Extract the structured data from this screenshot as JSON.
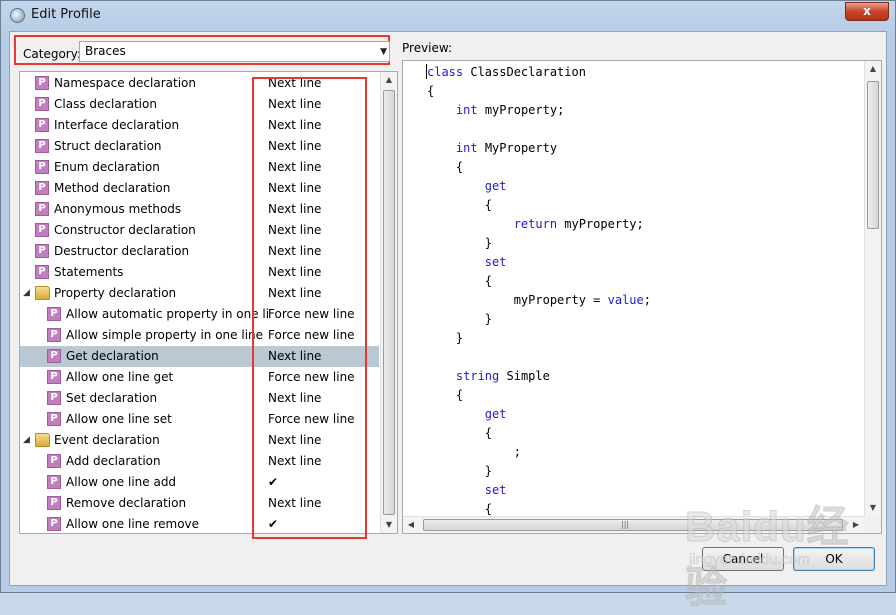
{
  "window": {
    "title": "Edit Profile",
    "close_label": "x",
    "icon": "app-gear-icon"
  },
  "category": {
    "label": "Category:",
    "selected": "Braces",
    "dropdown_icon": "chevron-down-icon"
  },
  "tree": {
    "rows": [
      {
        "label": "Namespace declaration",
        "value": "Next line",
        "level": 0,
        "icon": "p",
        "selected": false
      },
      {
        "label": "Class declaration",
        "value": "Next line",
        "level": 0,
        "icon": "p",
        "selected": false
      },
      {
        "label": "Interface declaration",
        "value": "Next line",
        "level": 0,
        "icon": "p",
        "selected": false
      },
      {
        "label": "Struct declaration",
        "value": "Next line",
        "level": 0,
        "icon": "p",
        "selected": false
      },
      {
        "label": "Enum declaration",
        "value": "Next line",
        "level": 0,
        "icon": "p",
        "selected": false
      },
      {
        "label": "Method declaration",
        "value": "Next line",
        "level": 0,
        "icon": "p",
        "selected": false
      },
      {
        "label": "Anonymous methods",
        "value": "Next line",
        "level": 0,
        "icon": "p",
        "selected": false
      },
      {
        "label": "Constructor declaration",
        "value": "Next line",
        "level": 0,
        "icon": "p",
        "selected": false
      },
      {
        "label": "Destructor declaration",
        "value": "Next line",
        "level": 0,
        "icon": "p",
        "selected": false
      },
      {
        "label": "Statements",
        "value": "Next line",
        "level": 0,
        "icon": "p",
        "selected": false
      },
      {
        "label": "Property declaration",
        "value": "Next line",
        "level": 0,
        "icon": "folder",
        "selected": false
      },
      {
        "label": "Allow automatic property in one line",
        "value": "Force new line",
        "level": 1,
        "icon": "p",
        "selected": false
      },
      {
        "label": "Allow simple property in one line",
        "value": "Force new line",
        "level": 1,
        "icon": "p",
        "selected": false
      },
      {
        "label": "Get declaration",
        "value": "Next line",
        "level": 1,
        "icon": "p",
        "selected": true
      },
      {
        "label": "Allow one line get",
        "value": "Force new line",
        "level": 1,
        "icon": "p",
        "selected": false
      },
      {
        "label": "Set declaration",
        "value": "Next line",
        "level": 1,
        "icon": "p",
        "selected": false
      },
      {
        "label": "Allow one line set",
        "value": "Force new line",
        "level": 1,
        "icon": "p",
        "selected": false
      },
      {
        "label": "Event declaration",
        "value": "Next line",
        "level": 0,
        "icon": "folder",
        "selected": false
      },
      {
        "label": "Add declaration",
        "value": "Next line",
        "level": 1,
        "icon": "p",
        "selected": false
      },
      {
        "label": "Allow one line add",
        "value": "",
        "checked": true,
        "level": 1,
        "icon": "p",
        "selected": false
      },
      {
        "label": "Remove declaration",
        "value": "Next line",
        "level": 1,
        "icon": "p",
        "selected": false
      },
      {
        "label": "Allow one line remove",
        "value": "",
        "checked": true,
        "level": 1,
        "icon": "p",
        "selected": false
      }
    ],
    "p_glyph": "P",
    "check_glyph": "✔",
    "expanded_glyph": "◢"
  },
  "preview": {
    "label": "Preview:",
    "lines": [
      [
        {
          "t": "class",
          "k": true
        },
        {
          "t": " ClassDeclaration"
        }
      ],
      [
        {
          "t": "{"
        }
      ],
      [
        {
          "t": "    "
        },
        {
          "t": "int",
          "k": true
        },
        {
          "t": " myProperty;"
        }
      ],
      [
        {
          "t": ""
        }
      ],
      [
        {
          "t": "    "
        },
        {
          "t": "int",
          "k": true
        },
        {
          "t": " MyProperty"
        }
      ],
      [
        {
          "t": "    {"
        }
      ],
      [
        {
          "t": "        "
        },
        {
          "t": "get",
          "k": true
        }
      ],
      [
        {
          "t": "        {"
        }
      ],
      [
        {
          "t": "            "
        },
        {
          "t": "return",
          "k": true
        },
        {
          "t": " myProperty;"
        }
      ],
      [
        {
          "t": "        }"
        }
      ],
      [
        {
          "t": "        "
        },
        {
          "t": "set",
          "k": true
        }
      ],
      [
        {
          "t": "        {"
        }
      ],
      [
        {
          "t": "            myProperty = "
        },
        {
          "t": "value",
          "k": true
        },
        {
          "t": ";"
        }
      ],
      [
        {
          "t": "        }"
        }
      ],
      [
        {
          "t": "    }"
        }
      ],
      [
        {
          "t": ""
        }
      ],
      [
        {
          "t": "    "
        },
        {
          "t": "string",
          "k": true
        },
        {
          "t": " Simple"
        }
      ],
      [
        {
          "t": "    {"
        }
      ],
      [
        {
          "t": "        "
        },
        {
          "t": "get",
          "k": true
        }
      ],
      [
        {
          "t": "        {"
        }
      ],
      [
        {
          "t": "            ;"
        }
      ],
      [
        {
          "t": "        }"
        }
      ],
      [
        {
          "t": "        "
        },
        {
          "t": "set",
          "k": true
        }
      ],
      [
        {
          "t": "        {"
        }
      ]
    ],
    "keyword_color": "#1c1ccf"
  },
  "buttons": {
    "cancel": "Cancel",
    "ok": "OK"
  },
  "watermark": {
    "logo": "Baidu经验",
    "sub": "jingyan.baidu.com"
  },
  "colors": {
    "highlight_border": "#e53935",
    "selected_row": "#b9c8d2",
    "p_icon": "#c27fbf"
  }
}
